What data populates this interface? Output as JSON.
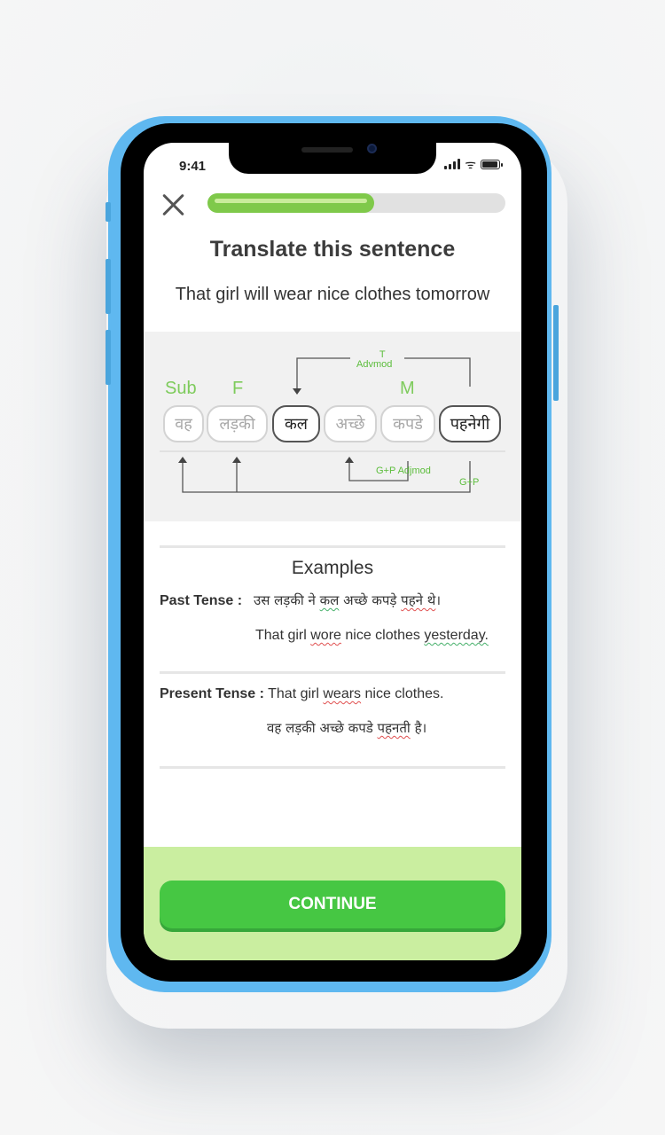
{
  "status_bar": {
    "time": "9:41"
  },
  "lesson": {
    "progress_fraction": 0.56,
    "title": "Translate this sentence",
    "sentence": "That girl will wear nice clothes tomorrow"
  },
  "diagram": {
    "tags": {
      "sub": "Sub",
      "f": "F",
      "m": "M"
    },
    "arc_top_label_line1": "T",
    "arc_top_label_line2": "Advmod",
    "arc_adjmod_label": "G+P Adjmod",
    "arc_gp_label": "G+P",
    "words": [
      "वह",
      "लड़की",
      "कल",
      "अच्छे",
      "कपडे",
      "पहनेगी"
    ]
  },
  "examples": {
    "heading": "Examples",
    "past": {
      "label": "Past Tense :",
      "hindi_parts": [
        "उस लड़की ने ",
        "कल",
        " अच्छे कपड़े ",
        "पहने थे",
        "।"
      ],
      "english_parts": [
        "That girl ",
        "wore",
        " nice clothes ",
        "yesterday."
      ]
    },
    "present": {
      "label": "Present Tense :",
      "english_parts": [
        " That girl ",
        "wears",
        " nice clothes."
      ],
      "hindi_parts": [
        "वह लड़की अच्छे कपडे ",
        "पहनती",
        " है।"
      ]
    }
  },
  "footer": {
    "continue_label": "CONTINUE"
  },
  "colors": {
    "accent": "#46c743",
    "footer_bg": "#caeea0",
    "frame": "#5fb8f0",
    "tag_green": "#7ecb5c"
  }
}
